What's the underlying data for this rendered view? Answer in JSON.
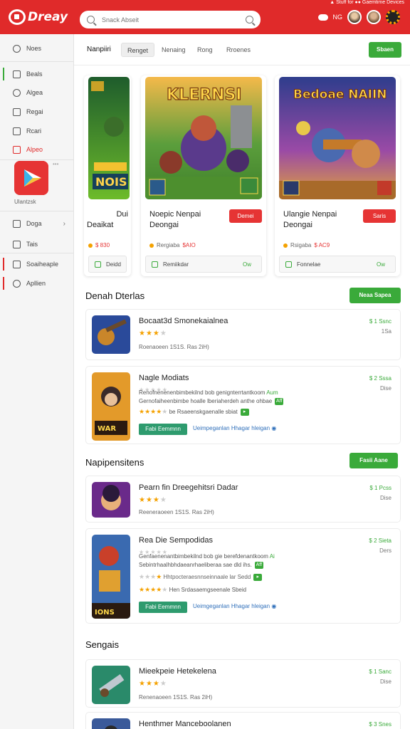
{
  "topbar": {
    "logo_text": "Dreay",
    "strip_text": "▲ Stuff for ●● Gaemtime Devices",
    "search_placeholder": "Snack Abseit",
    "user_label": "NG"
  },
  "sidebar": {
    "items": [
      {
        "label": "Noes",
        "icon": "clock-icon"
      },
      {
        "label": "Beals",
        "icon": "flag-icon"
      },
      {
        "label": "Algea",
        "icon": "gear-icon"
      },
      {
        "label": "Regai",
        "icon": "person-icon"
      },
      {
        "label": "Rcari",
        "icon": "box-icon"
      },
      {
        "label": "Alpeo",
        "icon": "box-icon"
      }
    ],
    "tile_label": "Ulantzsk",
    "tile_dots": "•••",
    "bottom_items": [
      {
        "label": "Doga",
        "icon": "book-icon"
      },
      {
        "label": "Tais",
        "icon": "grid-icon"
      },
      {
        "label": "Soaiheaple",
        "icon": "box-icon"
      },
      {
        "label": "Apllien",
        "icon": "gear-icon"
      }
    ]
  },
  "main": {
    "tabs": [
      "Nanpiiri",
      "Renget",
      "Nenaing",
      "Rong",
      "Rroenes"
    ],
    "header_button": "Sbaen",
    "featured": [
      {
        "title_line1": "Dui",
        "title_line2": "Deaikat",
        "button": "",
        "meta_label": "",
        "meta_price": "$ 830",
        "foot_label": "Deidd"
      },
      {
        "art_text": "KLERNSI",
        "title_line1": "Noepic Nenpai",
        "title_line2": "Deongai",
        "button": "Demei",
        "meta_label": "Rergiaba",
        "meta_price": "$AIO",
        "foot_label": "Remiikdar",
        "foot_right": "Ow"
      },
      {
        "art_text": "Bedoae NAIIN",
        "title_line1": "Ulangie Nenpai",
        "title_line2": "Deongai",
        "button": "Saris",
        "meta_label": "Rsigaba",
        "meta_price": "$ AC9",
        "foot_label": "Fonnelae",
        "foot_right": "Ow"
      }
    ],
    "section1": {
      "title": "Denah Dterlas",
      "button": "Neaa Sapea",
      "rows": [
        {
          "name": "Bocaat3d Smonekaialnea",
          "stars": 3,
          "info": "Roenaoeen  1S1S.  Ras 2iH)",
          "price": "$ 1 Ssnc",
          "price_sub": "1Sa"
        },
        {
          "name": "Nagle Modiats",
          "stars": 0,
          "desc1": "Renofnenenenbimbekilnd bob genignterrtantkoom",
          "desc1_tag": "Aum",
          "desc2": "Gernofaiheenbimbe hoalle lberiaherdeh anthe ohbae",
          "desc2_tag": "Aff",
          "stars2": 4,
          "desc3": "be Rsaeenskgaenalle sbiat",
          "tag_button": "Fabi Eemmnn",
          "link": "Ueimpeganlan Hhagar hleigan",
          "price": "$ 2 Sssa",
          "price_sub": "Dise"
        }
      ]
    },
    "section2": {
      "title": "Napipensitens",
      "button": "Fasii Aane",
      "rows": [
        {
          "name": "Pearn fin Dreegehitsri Dadar",
          "stars": 3,
          "info": "Reeneraoeen  1S1S.  Ras 2iH)",
          "price": "$ 1 Pcss",
          "price_sub": "Dise"
        },
        {
          "name": "Rea Die Sempodidas",
          "stars": 0,
          "desc1": "Genfaenenantbimbekilnd bob gie berefdenantkoom",
          "desc1_tag": "Ai",
          "desc2": "Sebintrhaalhbhdaeanrhaeliberaa sae dld ihs.",
          "desc2_tag": "Aff",
          "stars2": 4,
          "desc3": "Hen Srdasaemgseenale Sbeid",
          "tag_button": "Fabi Eemmnn",
          "link": "Ueimgeganlan Hhagar hleigan",
          "price": "$ 2 Sieta",
          "price_sub": "Ders"
        }
      ]
    },
    "section3": {
      "title": "Sengais",
      "rows": [
        {
          "name": "Mieekpeie Hetekelena",
          "stars": 3,
          "info": "Renenaoeen  1S1S.  Ras 2iH)",
          "price": "$ 1 Sanc",
          "price_sub": "Dise"
        },
        {
          "name": "Henthmer Manceboolanen",
          "price": "$ 3 Snes"
        }
      ]
    }
  },
  "colors": {
    "brand_red": "#e02a2a",
    "accent_green": "#3aaa3a",
    "star": "#f4a100",
    "link_blue": "#2f6fba"
  }
}
